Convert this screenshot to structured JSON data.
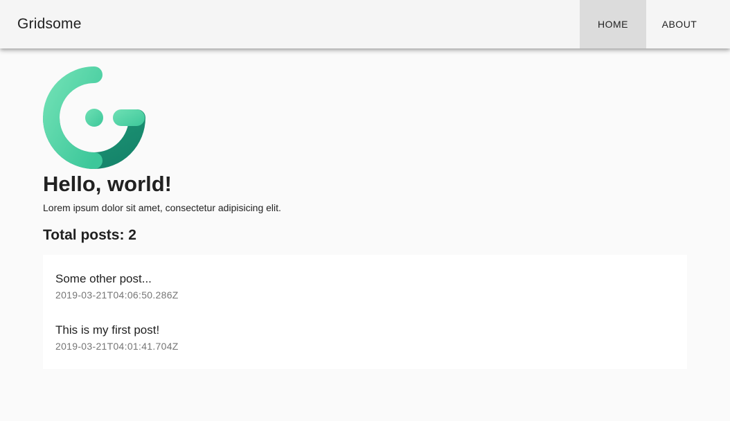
{
  "toolbar": {
    "brand": "Gridsome",
    "nav": [
      {
        "label": "HOME",
        "active": true
      },
      {
        "label": "ABOUT",
        "active": false
      }
    ]
  },
  "main": {
    "logo_icon": "gridsome-logo-icon",
    "title": "Hello, world!",
    "intro": "Lorem ipsum dolor sit amet, consectetur adipisicing elit.",
    "total_posts_label": "Total posts: 2",
    "posts": [
      {
        "title": "Some other post...",
        "date": "2019-03-21T04:06:50.286Z"
      },
      {
        "title": "This is my first post!",
        "date": "2019-03-21T04:01:41.704Z"
      }
    ]
  },
  "colors": {
    "logo_light": "#5fd9a9",
    "logo_dark": "#178a6d",
    "toolbar_bg": "#f5f5f5",
    "active_nav_bg": "#dcdcdc",
    "page_bg": "#fafafa"
  }
}
